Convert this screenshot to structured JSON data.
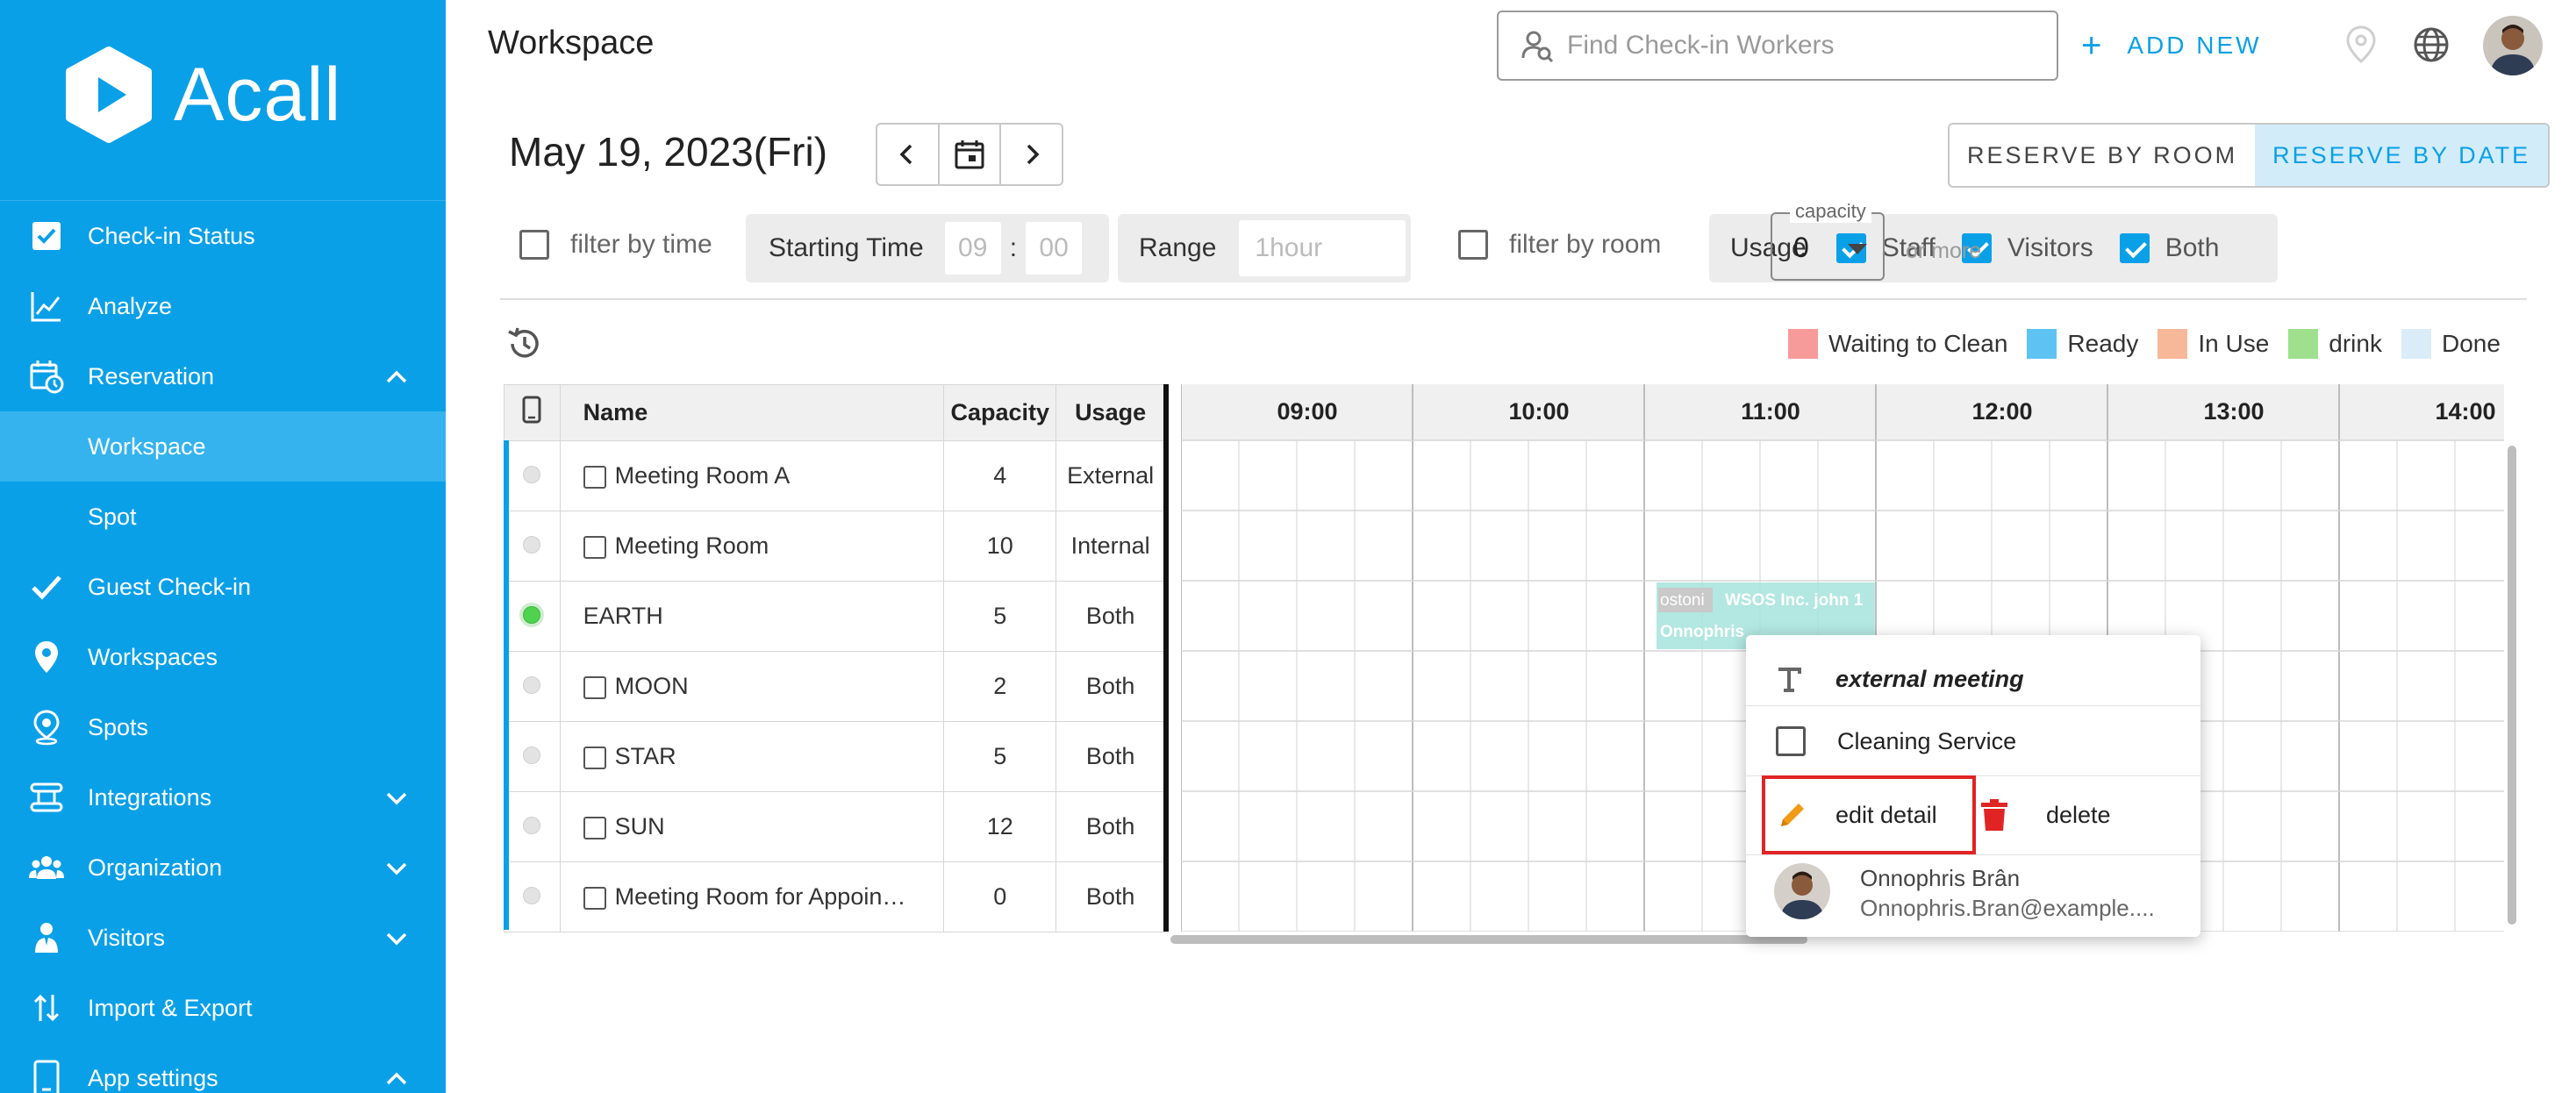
{
  "app": {
    "brand": "Acall"
  },
  "sidebar": {
    "items": [
      {
        "label": "Check-in Status",
        "icon": "checkbox-icon"
      },
      {
        "label": "Analyze",
        "icon": "chart-icon"
      },
      {
        "label": "Reservation",
        "icon": "calendar-clock-icon",
        "expanded": true
      },
      {
        "label": "Workspace",
        "sub": true,
        "active": true
      },
      {
        "label": "Spot",
        "sub": true
      },
      {
        "label": "Guest Check-in",
        "icon": "check-icon"
      },
      {
        "label": "Workspaces",
        "icon": "map-pin-icon"
      },
      {
        "label": "Spots",
        "icon": "location-icon"
      },
      {
        "label": "Integrations",
        "icon": "integrations-icon"
      },
      {
        "label": "Organization",
        "icon": "group-icon"
      },
      {
        "label": "Visitors",
        "icon": "visitor-icon"
      },
      {
        "label": "Import & Export",
        "icon": "import-export-icon"
      },
      {
        "label": "App settings",
        "icon": "tablet-icon"
      }
    ]
  },
  "header": {
    "title": "Workspace",
    "search_placeholder": "Find Check-in Workers",
    "add_new": "ADD NEW"
  },
  "date_bar": {
    "date": "May 19, 2023(Fri)",
    "reserve_by_room": "RESERVE BY ROOM",
    "reserve_by_date": "RESERVE BY DATE"
  },
  "filters": {
    "filter_by_time": "filter by time",
    "starting_time": "Starting Time",
    "hour": "09",
    "colon": ":",
    "minute": "00",
    "range": "Range",
    "range_value": "1hour",
    "filter_by_room": "filter by room",
    "usage": "Usage",
    "staff": "Staff",
    "visitors": "Visitors",
    "both": "Both",
    "capacity_label": "capacity",
    "capacity_value": "0",
    "or_more": "or more"
  },
  "legend": [
    {
      "label": "Waiting to Clean",
      "color": "#f79a9a"
    },
    {
      "label": "Ready",
      "color": "#5ec3f2"
    },
    {
      "label": "In Use",
      "color": "#f7b89a"
    },
    {
      "label": "drink",
      "color": "#9ee08e"
    },
    {
      "label": "Done",
      "color": "#d9ecf8"
    }
  ],
  "table": {
    "headers": {
      "name": "Name",
      "capacity": "Capacity",
      "usage": "Usage"
    },
    "rows": [
      {
        "name": "Meeting Room A",
        "capacity": "4",
        "usage": "External",
        "checkbox": true,
        "status": "idle"
      },
      {
        "name": "Meeting Room",
        "capacity": "10",
        "usage": "Internal",
        "checkbox": true,
        "status": "idle"
      },
      {
        "name": "EARTH",
        "capacity": "5",
        "usage": "Both",
        "checkbox": false,
        "status": "active"
      },
      {
        "name": "MOON",
        "capacity": "2",
        "usage": "Both",
        "checkbox": true,
        "status": "idle"
      },
      {
        "name": "STAR",
        "capacity": "5",
        "usage": "Both",
        "checkbox": true,
        "status": "idle"
      },
      {
        "name": "SUN",
        "capacity": "12",
        "usage": "Both",
        "checkbox": true,
        "status": "idle"
      },
      {
        "name": "Meeting Room for Appoin…",
        "capacity": "0",
        "usage": "Both",
        "checkbox": true,
        "status": "idle"
      }
    ]
  },
  "timeline": {
    "hours": [
      "09:00",
      "10:00",
      "11:00",
      "12:00",
      "13:00",
      "14:00"
    ],
    "booking": {
      "row": 2,
      "start_hour": 11.0,
      "end_hour": 11.95,
      "tag": "ostoni",
      "company": "WSOS Inc. john 1",
      "person": "Onnophris",
      "color": "#a6e3dc"
    }
  },
  "popup": {
    "title": "external meeting",
    "cleaning": "Cleaning Service",
    "edit": "edit detail",
    "delete": "delete",
    "user_name": "Onnophris Brân",
    "user_email": "Onnophris.Bran@example...."
  }
}
